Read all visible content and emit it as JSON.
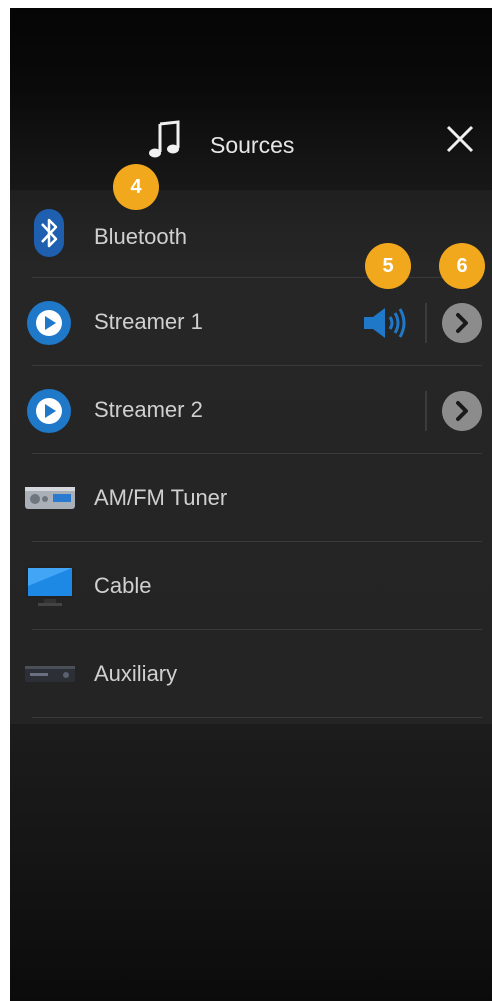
{
  "header": {
    "title": "Sources",
    "music_icon": "music-note-icon",
    "close_icon": "close-icon"
  },
  "sources": [
    {
      "label": "Bluetooth",
      "icon": "bluetooth-icon"
    },
    {
      "label": "Streamer 1",
      "icon": "streamer-icon",
      "playing": true,
      "speaker_icon": "speaker-volume-icon",
      "has_details": true
    },
    {
      "label": "Streamer 2",
      "icon": "streamer-icon",
      "has_details": true
    },
    {
      "label": "AM/FM Tuner",
      "icon": "tuner-icon"
    },
    {
      "label": "Cable",
      "icon": "tv-icon"
    },
    {
      "label": "Auxiliary",
      "icon": "aux-device-icon"
    }
  ],
  "callouts": [
    "4",
    "5",
    "6"
  ],
  "colors": {
    "accent_blue": "#1f78c8",
    "callout": "#f1a81c",
    "chevron_bg": "#8c8c8c"
  }
}
